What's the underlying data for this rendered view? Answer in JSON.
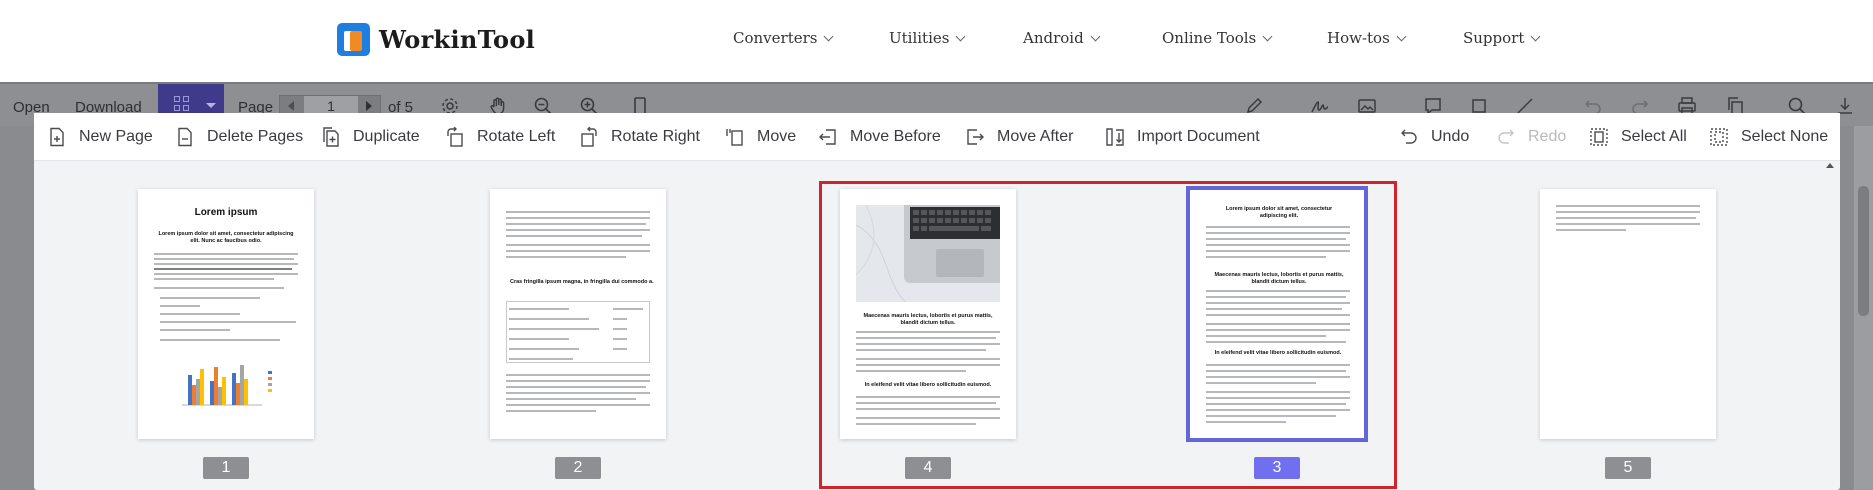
{
  "header": {
    "brand": "WorkinTool",
    "nav": [
      {
        "label": "Converters"
      },
      {
        "label": "Utilities"
      },
      {
        "label": "Android"
      },
      {
        "label": "Online Tools"
      },
      {
        "label": "How-tos"
      },
      {
        "label": "Support"
      }
    ]
  },
  "viewer_toolbar": {
    "open_label": "Open",
    "download_label": "Download",
    "page_label": "Page",
    "page_value": "1",
    "page_total": "of 5"
  },
  "organize_toolbar": {
    "new_page": "New Page",
    "delete_pages": "Delete Pages",
    "duplicate": "Duplicate",
    "rotate_left": "Rotate Left",
    "rotate_right": "Rotate Right",
    "move": "Move",
    "move_before": "Move Before",
    "move_after": "Move After",
    "import_document": "Import Document",
    "undo": "Undo",
    "redo": "Redo",
    "select_all": "Select All",
    "select_none": "Select None"
  },
  "pages": [
    {
      "number": "1",
      "title": "Lorem ipsum",
      "subtitle": "Lorem ipsum dolor sit amet, consectetur adipiscing elit. Nunc ac faucibus odio."
    },
    {
      "number": "2",
      "heading": "Cras fringilla ipsum magna, in fringilla dui commodo a."
    },
    {
      "number": "4",
      "heading": "Maecenas mauris lectus, lobortis et purus mattis, blandit dictum tellus.",
      "heading2": "In eleifend velit vitae libero sollicitudin euismod."
    },
    {
      "number": "3",
      "title": "Lorem ipsum dolor sit amet, consectetur adipiscing elit.",
      "heading": "Maecenas mauris lectus, lobortis et purus mattis, blandit dictum tellus.",
      "heading2": "In eleifend velit vitae libero sollicitudin euismod."
    },
    {
      "number": "5"
    }
  ],
  "colors": {
    "selection_outline": "#d1232a",
    "active_page_border": "#6366d6",
    "active_badge": "#6f6ff0",
    "grid_button": "#3f3a8a",
    "logo_blue": "#1e7fe0",
    "logo_orange": "#f08a24"
  },
  "icons": [
    "document-add-icon",
    "document-remove-icon",
    "duplicate-icon",
    "rotate-left-icon",
    "rotate-right-icon",
    "move-icon",
    "move-before-icon",
    "move-after-icon",
    "import-icon",
    "undo-icon",
    "redo-icon",
    "select-all-icon",
    "select-none-icon"
  ]
}
